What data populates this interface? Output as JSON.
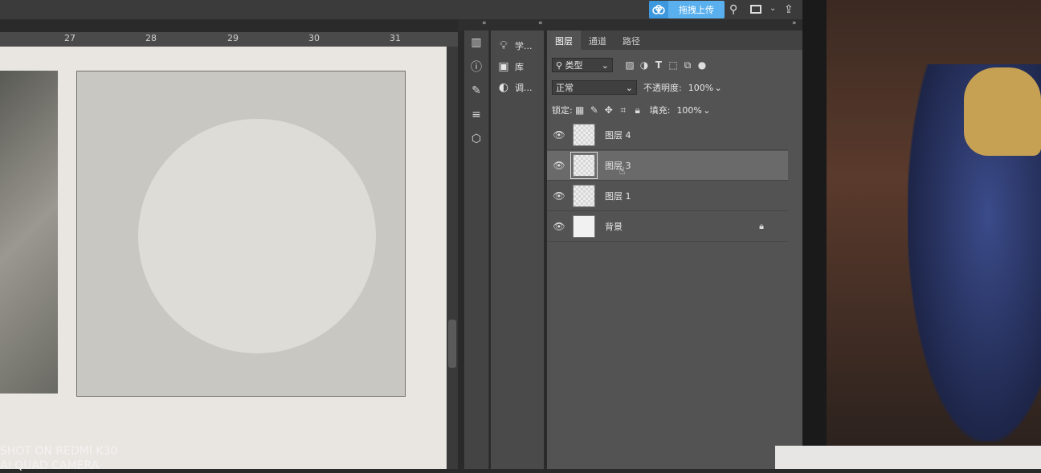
{
  "topbar": {
    "upload_button": "拖拽上传"
  },
  "ruler": {
    "ticks": [
      "27",
      "28",
      "29",
      "30",
      "31"
    ]
  },
  "mini_panel": {
    "items": [
      {
        "label": "学...",
        "icon": "lightbulb-icon"
      },
      {
        "label": "库",
        "icon": "library-icon"
      },
      {
        "label": "调...",
        "icon": "adjustments-icon"
      }
    ]
  },
  "layers_panel": {
    "tabs": [
      "图层",
      "通道",
      "路径"
    ],
    "filter_kind": "类型",
    "blend_mode": "正常",
    "opacity_label": "不透明度:",
    "opacity_value": "100%",
    "lock_label": "锁定:",
    "fill_label": "填充:",
    "fill_value": "100%",
    "layers": [
      {
        "name": "图层 4",
        "selected": false,
        "locked": false
      },
      {
        "name": "图层 3",
        "selected": true,
        "locked": false
      },
      {
        "name": "图层 1",
        "selected": false,
        "locked": false
      },
      {
        "name": "背景",
        "selected": false,
        "locked": true
      }
    ]
  },
  "watermark": {
    "line1": "SHOT ON REDMI K30",
    "line2": "AI QUAD CAMERA"
  },
  "colors": {
    "panel_bg": "#535353",
    "accent_upload": "#5ab0ef"
  }
}
